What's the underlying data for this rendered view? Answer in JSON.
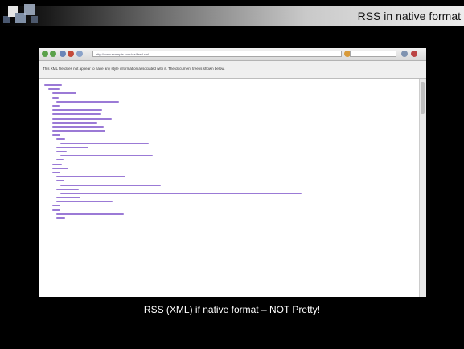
{
  "slide": {
    "title": "RSS in native format",
    "caption": "RSS (XML) if native format – NOT Pretty!"
  },
  "browser": {
    "address": "http://www.example.com/rss/feed.xml",
    "infobar": "This XML file does not appear to have any style information associated with it. The document tree is shown below."
  },
  "colors": {
    "accent": "#7f8fa6",
    "xml_tag": "#9b7ad6",
    "caption_text": "#ffffff"
  },
  "icons": [
    "back-icon",
    "forward-icon",
    "reload-icon",
    "stop-icon",
    "home-icon",
    "search-icon"
  ]
}
